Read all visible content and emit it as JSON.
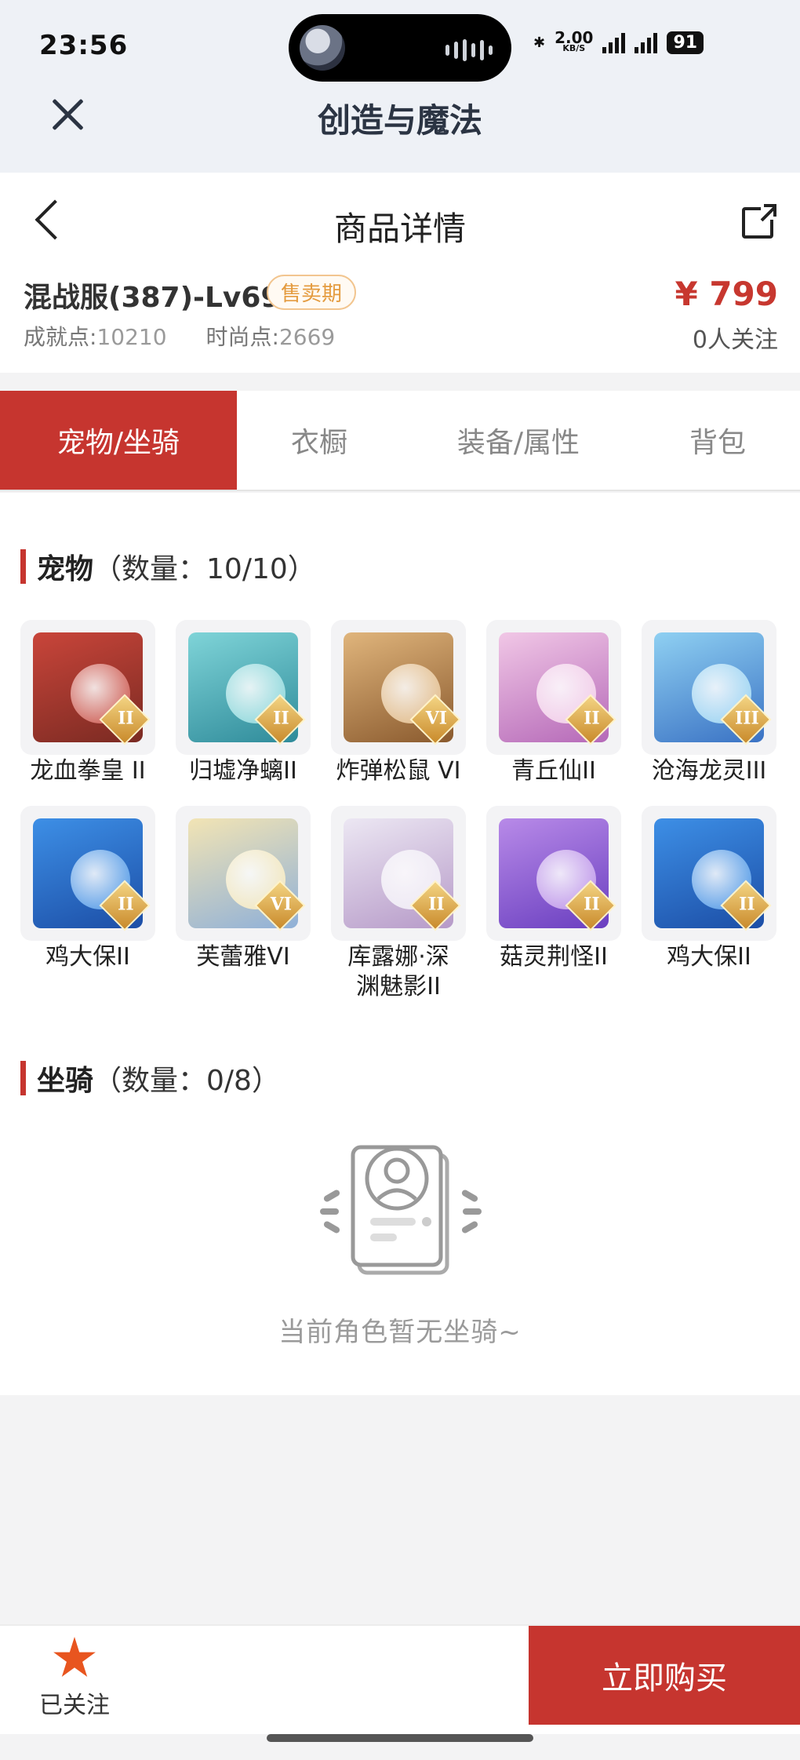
{
  "status_bar": {
    "time": "23:56",
    "net_speed": "2.00",
    "net_unit": "KB/S",
    "battery": "91"
  },
  "app_header": {
    "title": "创造与魔法"
  },
  "detail": {
    "page_title": "商品详情",
    "server": "混战服(387)-Lv69",
    "badge": "售卖期",
    "price": "¥ 799",
    "achievement_label": "成就点:",
    "achievement_value": "10210",
    "fashion_label": "时尚点:",
    "fashion_value": "2669",
    "followers": "0人关注"
  },
  "tabs": [
    {
      "label": "宠物/坐骑",
      "active": true
    },
    {
      "label": "衣橱",
      "active": false
    },
    {
      "label": "装备/属性",
      "active": false
    },
    {
      "label": "背包",
      "active": false
    }
  ],
  "pets_section": {
    "title": "宠物",
    "count": "（数量：10/10）"
  },
  "pets": [
    {
      "name": "龙血拳皇 II",
      "rank": "II",
      "colors": [
        "#c9453a",
        "#7a2a22"
      ]
    },
    {
      "name": "归墟净螭II",
      "rank": "II",
      "colors": [
        "#7fd4d8",
        "#2f8b9a"
      ]
    },
    {
      "name": "炸弹松鼠 VI",
      "rank": "VI",
      "colors": [
        "#e0b57c",
        "#8a5a2e"
      ]
    },
    {
      "name": "青丘仙II",
      "rank": "II",
      "colors": [
        "#f1c7e6",
        "#b569b8"
      ]
    },
    {
      "name": "沧海龙灵III",
      "rank": "III",
      "colors": [
        "#8fd0f2",
        "#3a72c4"
      ]
    },
    {
      "name": "鸡大保II",
      "rank": "II",
      "colors": [
        "#3d8fe6",
        "#1c4ea6"
      ]
    },
    {
      "name": "芙蕾雅VI",
      "rank": "VI",
      "colors": [
        "#f2e4b4",
        "#8fb0d8"
      ]
    },
    {
      "name": "库露娜·深渊魅影II",
      "rank": "II",
      "colors": [
        "#ece7f3",
        "#b69ac8"
      ]
    },
    {
      "name": "菇灵荆怪II",
      "rank": "II",
      "colors": [
        "#b88ae8",
        "#6a3fc0"
      ]
    },
    {
      "name": "鸡大保II",
      "rank": "II",
      "colors": [
        "#3d8fe6",
        "#1c4ea6"
      ]
    }
  ],
  "mounts_section": {
    "title": "坐骑",
    "count": "（数量：0/8）"
  },
  "empty_text": "当前角色暂无坐骑~",
  "bottom_bar": {
    "follow_label": "已关注",
    "buy_label": "立即购买"
  },
  "colors": {
    "accent": "#c6352f",
    "badge": "#e49b3f",
    "star": "#e8551f"
  }
}
